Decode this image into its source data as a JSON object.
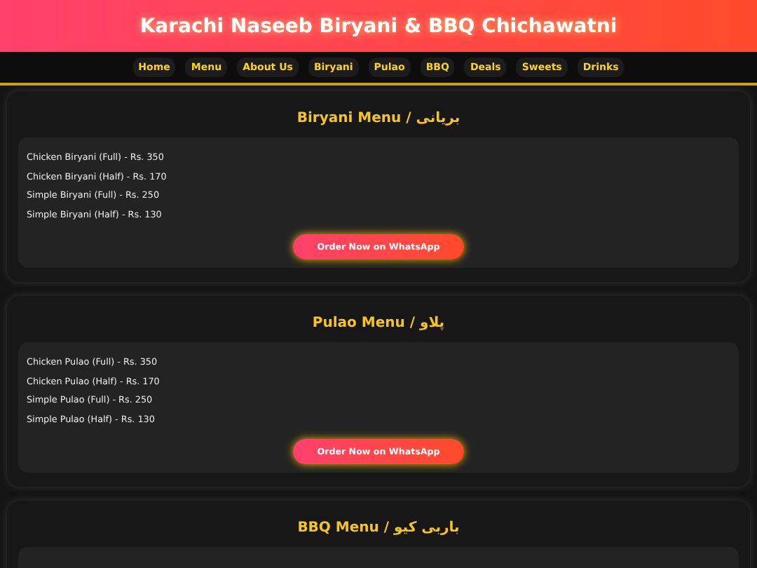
{
  "header": {
    "title": "Karachi Naseeb Biryani & BBQ Chichawatni"
  },
  "nav": {
    "items": [
      {
        "label": "Home"
      },
      {
        "label": "Menu"
      },
      {
        "label": "About Us"
      },
      {
        "label": "Biryani"
      },
      {
        "label": "Pulao"
      },
      {
        "label": "BBQ"
      },
      {
        "label": "Deals"
      },
      {
        "label": "Sweets"
      },
      {
        "label": "Drinks"
      }
    ]
  },
  "sections": [
    {
      "title": "Biryani Menu / بریانی",
      "items": [
        "Chicken Biryani (Full) - Rs. 350",
        "Chicken Biryani (Half) - Rs. 170",
        "Simple Biryani (Full) - Rs. 250",
        "Simple Biryani (Half) - Rs. 130"
      ],
      "button": "Order Now on WhatsApp"
    },
    {
      "title": "Pulao Menu / پلاو",
      "items": [
        "Chicken Pulao (Full) - Rs. 350",
        "Chicken Pulao (Half) - Rs. 170",
        "Simple Pulao (Full) - Rs. 250",
        "Simple Pulao (Half) - Rs. 130"
      ],
      "button": "Order Now on WhatsApp"
    },
    {
      "title": "BBQ Menu / باربی کیو"
    }
  ]
}
